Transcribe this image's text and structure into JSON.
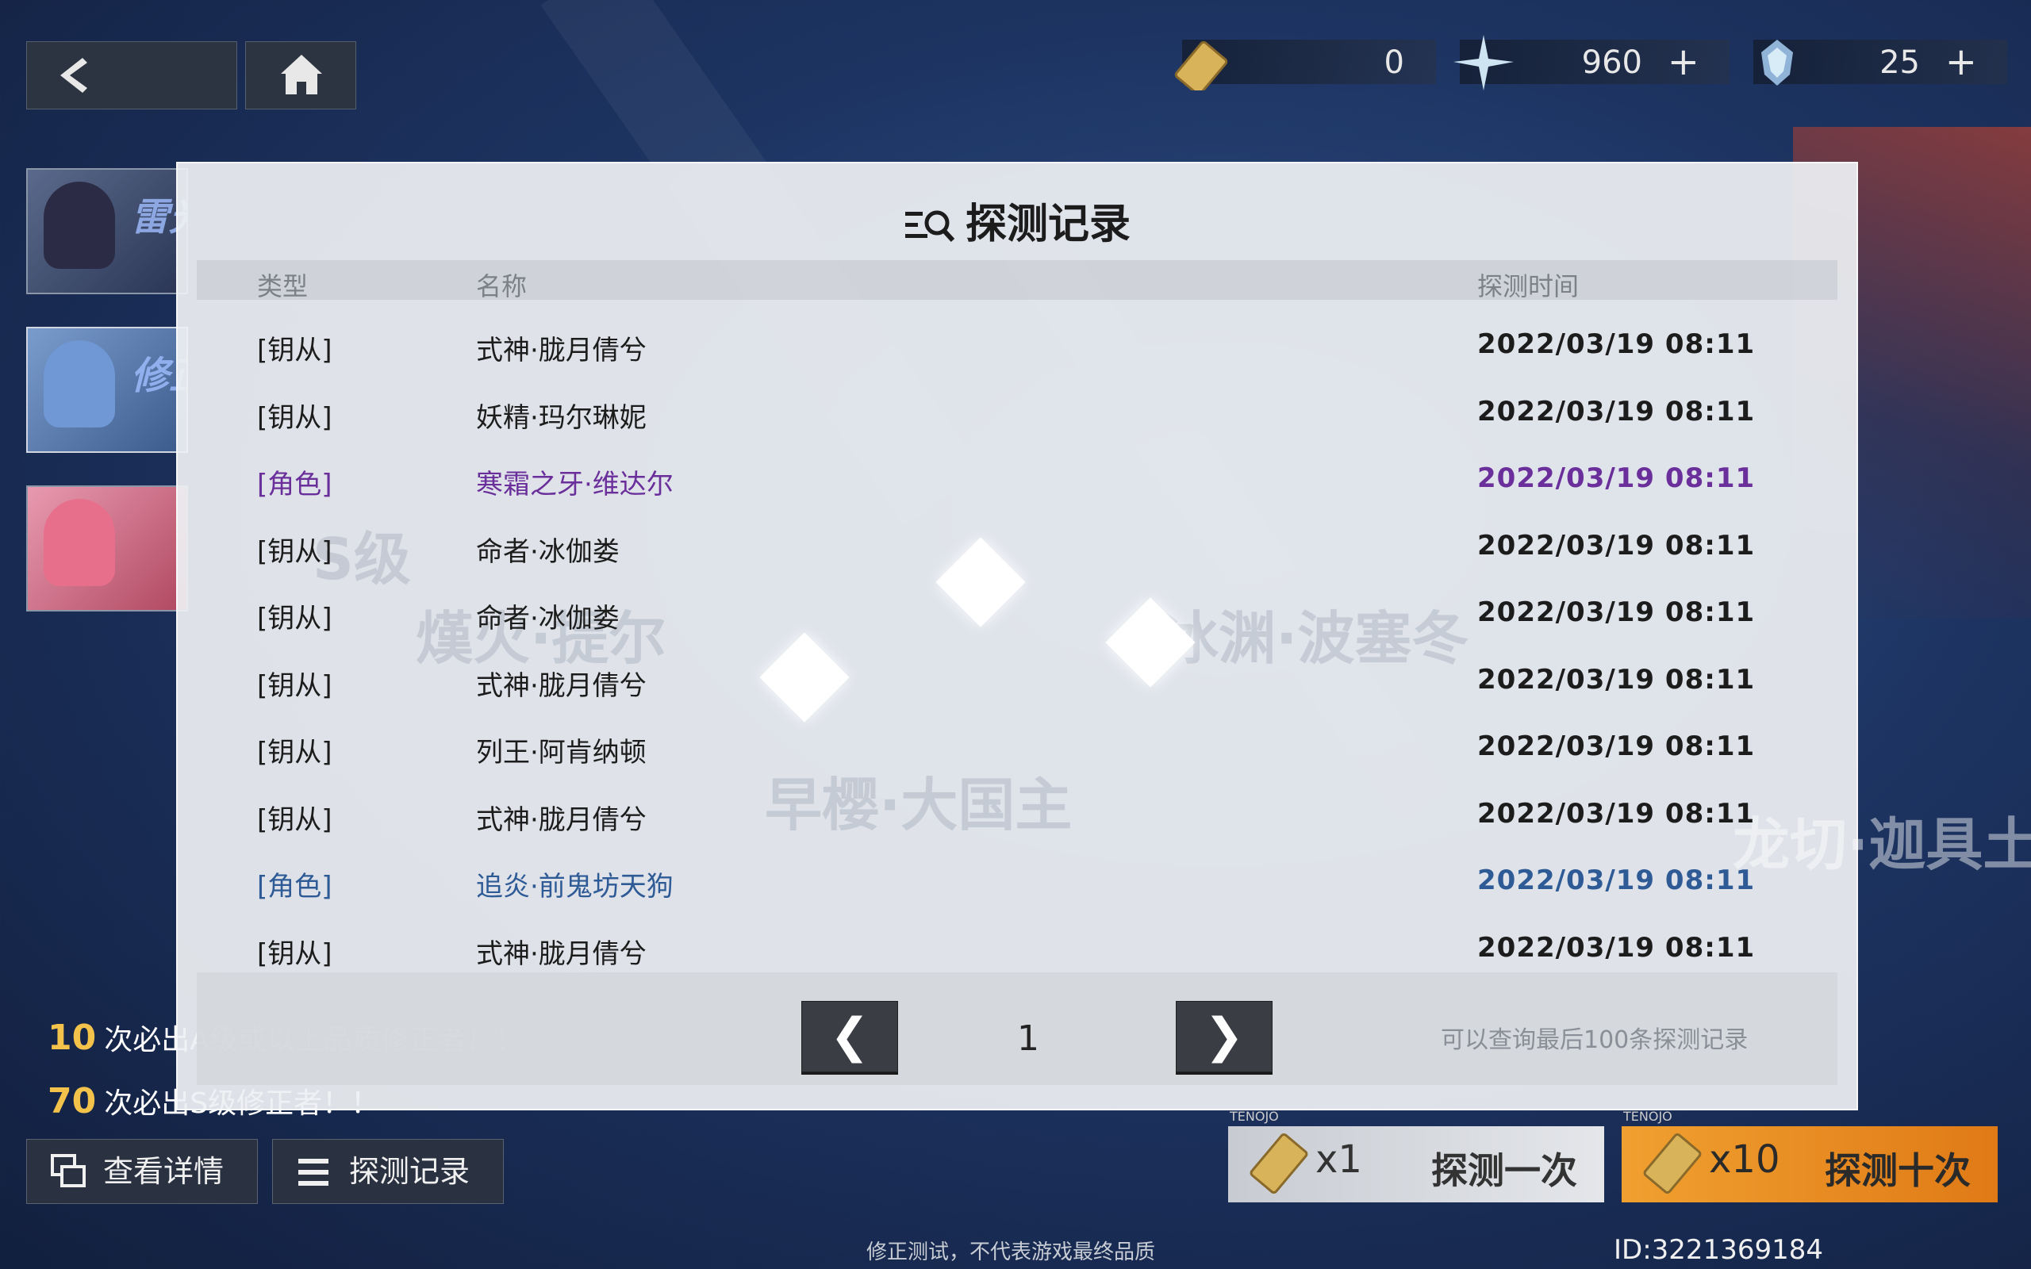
{
  "colors": {
    "character_purple": "#6a2f9a",
    "character_blue": "#2e5a96",
    "gold": "#f2c24a",
    "orange_button": "#e88a1e"
  },
  "topbar": {
    "back_icon": "chevron-left-icon",
    "home_icon": "home-icon",
    "currencies": [
      {
        "icon": "ticket-icon",
        "value": "0",
        "plus": ""
      },
      {
        "icon": "crystal-star-icon",
        "value": "960",
        "plus": "+"
      },
      {
        "icon": "gem-cluster-icon",
        "value": "25",
        "plus": "+"
      }
    ]
  },
  "banners": [
    {
      "title": "雷光的剑息"
    },
    {
      "title": "修正者"
    },
    {
      "title": ""
    }
  ],
  "pity": [
    {
      "num": "10",
      "text": "次必出A级或以上品质修正者！！"
    },
    {
      "num": "70",
      "text": "次必出S级修正者！！"
    }
  ],
  "bottom_buttons": {
    "details": "查看详情",
    "records": "探测记录"
  },
  "draw": {
    "single": {
      "tag": "TENOJO",
      "count": "x1",
      "label": "探测一次"
    },
    "ten": {
      "tag": "TENOJO",
      "count": "x10",
      "label": "探测十次"
    }
  },
  "footer": {
    "note": "修正测试，不代表游戏最终品质",
    "player_id": "ID:3221369184"
  },
  "modal": {
    "title": "探测记录",
    "columns": {
      "type": "类型",
      "name": "名称",
      "time": "探测时间"
    },
    "rows": [
      {
        "type": "[钥从]",
        "name": "式神·胧月倩兮",
        "time": "2022/03/19 08:11",
        "tone": "normal"
      },
      {
        "type": "[钥从]",
        "name": "妖精·玛尔琳妮",
        "time": "2022/03/19 08:11",
        "tone": "normal"
      },
      {
        "type": "[角色]",
        "name": "寒霜之牙·维达尔",
        "time": "2022/03/19 08:11",
        "tone": "purple"
      },
      {
        "type": "[钥从]",
        "name": "命者·冰伽娄",
        "time": "2022/03/19 08:11",
        "tone": "normal"
      },
      {
        "type": "[钥从]",
        "name": "命者·冰伽娄",
        "time": "2022/03/19 08:11",
        "tone": "normal"
      },
      {
        "type": "[钥从]",
        "name": "式神·胧月倩兮",
        "time": "2022/03/19 08:11",
        "tone": "normal"
      },
      {
        "type": "[钥从]",
        "name": "列王·阿肯纳顿",
        "time": "2022/03/19 08:11",
        "tone": "normal"
      },
      {
        "type": "[钥从]",
        "name": "式神·胧月倩兮",
        "time": "2022/03/19 08:11",
        "tone": "normal"
      },
      {
        "type": "[角色]",
        "name": "追炎·前鬼坊天狗",
        "time": "2022/03/19 08:11",
        "tone": "blue"
      },
      {
        "type": "[钥从]",
        "name": "式神·胧月倩兮",
        "time": "2022/03/19 08:11",
        "tone": "normal"
      }
    ],
    "pager": {
      "prev": "❮",
      "page": "1",
      "next": "❯",
      "hint": "可以查询最后100条探测记录"
    },
    "watermarks": [
      "S级",
      "熯火·提尔",
      "冰渊·波塞冬",
      "早樱·大国主",
      "龙切·迦具土"
    ]
  }
}
